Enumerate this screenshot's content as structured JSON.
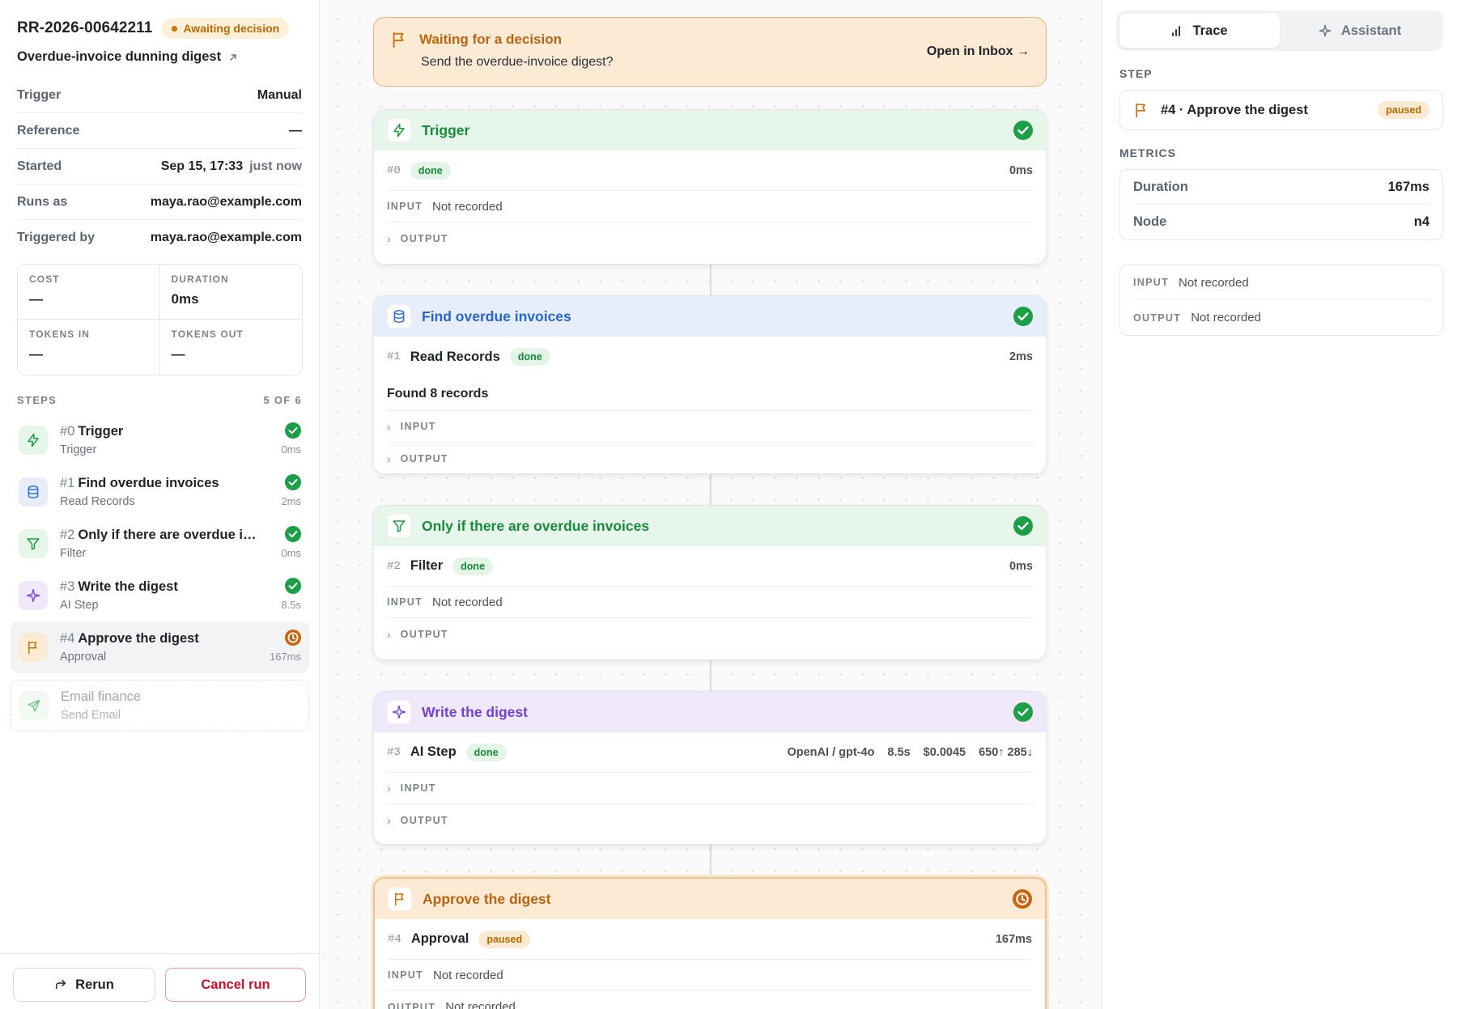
{
  "run": {
    "id": "RR-2026-00642211",
    "status_badge": "Awaiting decision",
    "flow_name": "Overdue-invoice dunning digest",
    "details": [
      {
        "key": "Trigger",
        "value": "Manual",
        "extra": ""
      },
      {
        "key": "Reference",
        "value": "—",
        "extra": ""
      },
      {
        "key": "Started",
        "value": "Sep 15, 17:33",
        "extra": "just now"
      },
      {
        "key": "Runs as",
        "value": "maya.rao@example.com",
        "extra": ""
      },
      {
        "key": "Triggered by",
        "value": "maya.rao@example.com",
        "extra": ""
      }
    ],
    "metrics": [
      {
        "label": "COST",
        "value": "—"
      },
      {
        "label": "DURATION",
        "value": "0ms"
      },
      {
        "label": "TOKENS IN",
        "value": "—"
      },
      {
        "label": "TOKENS OUT",
        "value": "—"
      }
    ]
  },
  "steps_header": {
    "label": "STEPS",
    "count": "5 OF 6"
  },
  "steps": [
    {
      "num": "#0",
      "title": "Trigger",
      "type": "Trigger",
      "duration": "0ms",
      "status": "done",
      "icon": "bolt-icon",
      "color": "#1f9d45",
      "bg": "#e6f6ea"
    },
    {
      "num": "#1",
      "title": "Find overdue invoices",
      "type": "Read Records",
      "duration": "2ms",
      "status": "done",
      "icon": "database-icon",
      "color": "#2f6fd6",
      "bg": "#e6eefc"
    },
    {
      "num": "#2",
      "title": "Only if there are overdue invoices",
      "type": "Filter",
      "duration": "0ms",
      "status": "done",
      "icon": "filter-icon",
      "color": "#1f9d45",
      "bg": "#e6f6ea"
    },
    {
      "num": "#3",
      "title": "Write the digest",
      "type": "AI Step",
      "duration": "8.5s",
      "status": "done",
      "icon": "sparkle-icon",
      "color": "#7c4ddb",
      "bg": "#efe9fb"
    },
    {
      "num": "#4",
      "title": "Approve the digest",
      "type": "Approval",
      "duration": "167ms",
      "status": "paused",
      "icon": "flag-icon",
      "color": "#c7740e",
      "bg": "#fcecd6"
    },
    {
      "num": "",
      "title": "Email finance",
      "type": "Send Email",
      "duration": "",
      "status": "pending",
      "icon": "send-icon",
      "color": "#52b56c",
      "bg": "#eef8f0"
    }
  ],
  "footer": {
    "rerun": "Rerun",
    "cancel": "Cancel run"
  },
  "banner": {
    "title": "Waiting for a decision",
    "subtitle": "Send the overdue-invoice digest?",
    "link": "Open in Inbox →"
  },
  "cards": [
    {
      "title": "Trigger",
      "num": "#0",
      "node": "",
      "status": "done",
      "duration": "0ms",
      "input": "Not recorded",
      "has_output": true
    },
    {
      "title": "Find overdue invoices",
      "num": "#1",
      "node": "Read Records",
      "status": "done",
      "duration": "2ms",
      "summary": "Found 8 records"
    },
    {
      "title": "Only if there are overdue invoices",
      "num": "#2",
      "node": "Filter",
      "status": "done",
      "duration": "0ms",
      "input": "Not recorded"
    },
    {
      "title": "Write the digest",
      "num": "#3",
      "node": "AI Step",
      "status": "done",
      "duration": "8.5s",
      "model": "OpenAI / gpt-4o",
      "cost": "$0.0045",
      "tokens": "650↑ 285↓"
    },
    {
      "title": "Approve the digest",
      "num": "#4",
      "node": "Approval",
      "status": "paused",
      "duration": "167ms",
      "input": "Not recorded",
      "output": "Not recorded"
    }
  ],
  "io_labels": {
    "input": "INPUT",
    "output": "OUTPUT"
  },
  "panel": {
    "tabs": [
      {
        "label": "Trace"
      },
      {
        "label": "Assistant"
      }
    ],
    "step_label": "STEP",
    "step_title": "#4 · Approve the digest",
    "step_status": "paused",
    "metrics_label": "METRICS",
    "metrics": [
      {
        "key": "Duration",
        "value": "167ms"
      },
      {
        "key": "Node",
        "value": "n4"
      }
    ],
    "input": "Not recorded",
    "output": "Not recorded"
  }
}
